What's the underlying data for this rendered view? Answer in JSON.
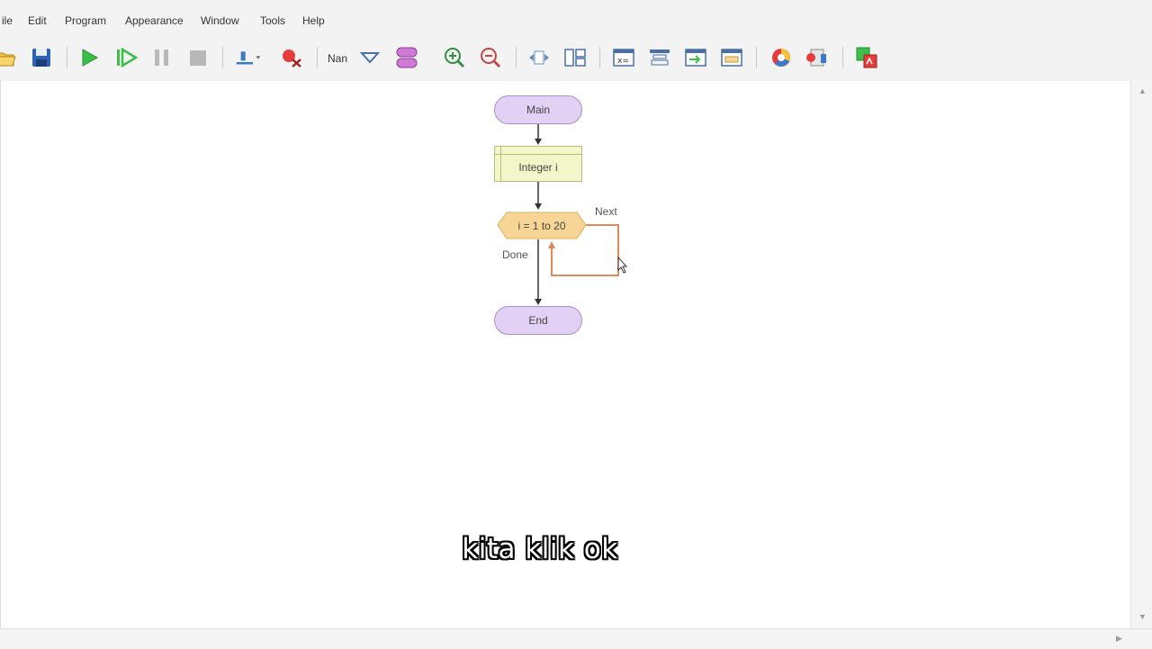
{
  "menu": {
    "items": [
      {
        "id": "file",
        "label": "ile"
      },
      {
        "id": "edit",
        "label": "Edit"
      },
      {
        "id": "program",
        "label": "Program"
      },
      {
        "id": "appearance",
        "label": "Appearance"
      },
      {
        "id": "window",
        "label": "Window"
      },
      {
        "id": "tools",
        "label": "Tools"
      },
      {
        "id": "help",
        "label": "Help"
      }
    ]
  },
  "toolbar": {
    "mode_label": "Nan",
    "icons": [
      "open-icon",
      "save-icon",
      "run-icon",
      "step-icon",
      "pause-icon",
      "stop-icon",
      "align-icon",
      "clear-breakpoints-icon",
      "mode-dropdown-icon",
      "variables-icon",
      "zoom-in-icon",
      "zoom-out-icon",
      "fit-icon",
      "layout-icon",
      "expression-icon",
      "flowchart-icon",
      "output-icon",
      "function-icon",
      "color-icon",
      "export-icon",
      "generate-code-icon"
    ]
  },
  "flowchart": {
    "start_label": "Main",
    "declare_label": "Integer i",
    "loop_label": "i = 1 to 20",
    "next_label": "Next",
    "done_label": "Done",
    "end_label": "End",
    "colors": {
      "terminal": "#e2d0f5",
      "declare": "#f2f6c8",
      "loop": "#f6d595",
      "loop_edge": "#e08a5a"
    }
  },
  "subtitle": "kita klik ok"
}
